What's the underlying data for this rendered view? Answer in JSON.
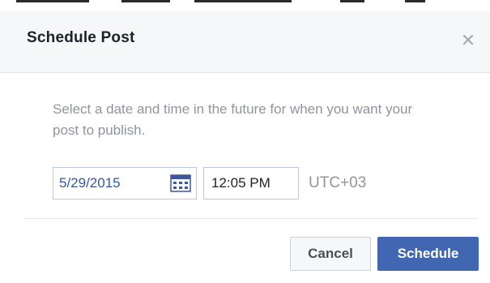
{
  "dialog": {
    "title": "Schedule Post",
    "instructions": "Select a date and time in the future for when you want your post to publish.",
    "date_value": "5/29/2015",
    "time_value": "12:05 PM",
    "timezone": "UTC+03",
    "cancel_label": "Cancel",
    "schedule_label": "Schedule"
  },
  "icons": {
    "close": "close-icon",
    "calendar": "calendar-icon"
  },
  "colors": {
    "primary_button": "#4267b2",
    "date_text": "#365899",
    "muted_text": "#90949c",
    "header_bg": "#f6f7f9"
  }
}
